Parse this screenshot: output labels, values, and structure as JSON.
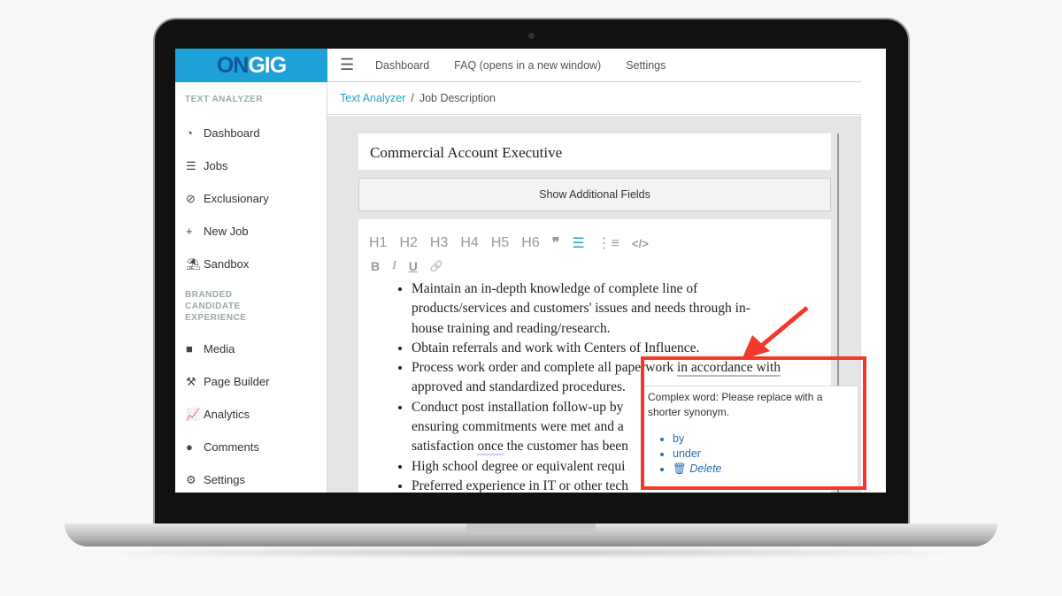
{
  "logo": {
    "part1": "ON",
    "part2": "GIG"
  },
  "topnav": [
    "Dashboard",
    "FAQ (opens in a new window)",
    "Settings"
  ],
  "breadcrumb": {
    "link": "Text Analyzer",
    "sep": "/",
    "current": "Job Description"
  },
  "sidebar": {
    "section1": "TEXT ANALYZER",
    "items1": [
      {
        "label": "Dashboard",
        "icon": "dashboard-icon"
      },
      {
        "label": "Jobs",
        "icon": "list-icon"
      },
      {
        "label": "Exclusionary",
        "icon": "ban-icon"
      },
      {
        "label": "New Job",
        "icon": "plus-icon"
      },
      {
        "label": "Sandbox",
        "icon": "umbrella-beach-icon"
      }
    ],
    "section2": "BRANDED CANDIDATE EXPERIENCE",
    "items2": [
      {
        "label": "Media",
        "icon": "video-icon"
      },
      {
        "label": "Page Builder",
        "icon": "hammer-icon"
      },
      {
        "label": "Analytics",
        "icon": "chart-icon"
      },
      {
        "label": "Comments",
        "icon": "comment-icon"
      },
      {
        "label": "Settings",
        "icon": "gear-icon"
      }
    ]
  },
  "job_title": "Commercial Account Executive",
  "additional_fields_label": "Show Additional Fields",
  "toolbar": {
    "headings": [
      "H1",
      "H2",
      "H3",
      "H4",
      "H5",
      "H6"
    ],
    "quote": "❞",
    "bullets": "☰",
    "numbered": "⋮≡",
    "code": "</>",
    "bold": "B",
    "italic": "I",
    "underline": "U",
    "link": "🔗"
  },
  "content": {
    "b1a": "Maintain an in-depth knowledge of complete line of",
    "b1b": "products/services and customers' issues and needs through in-",
    "b1c": "house training and reading/research.",
    "b2": "Obtain referrals and work with Centers of Influence.",
    "b3a": "Process work order and complete all paperwork ",
    "b3hl": "in accordance with",
    "b3b": "approved and standardized procedures.",
    "b4a": "Conduct post installation follow-up by",
    "b4b": "ensuring commitments were met and a",
    "b4c1": "satisfaction ",
    "b4c_hl": "once",
    "b4c2": " the customer has been",
    "b5": "High school degree or equivalent requi",
    "b6": "Preferred experience in IT or other tech"
  },
  "popup": {
    "message": "Complex word: Please replace with a shorter synonym.",
    "suggestions": [
      "by",
      "under"
    ],
    "delete": "Delete"
  },
  "colors": {
    "brand": "#1ea1d8",
    "highlight_box": "#f23a2a",
    "link": "#2a6eb0"
  }
}
